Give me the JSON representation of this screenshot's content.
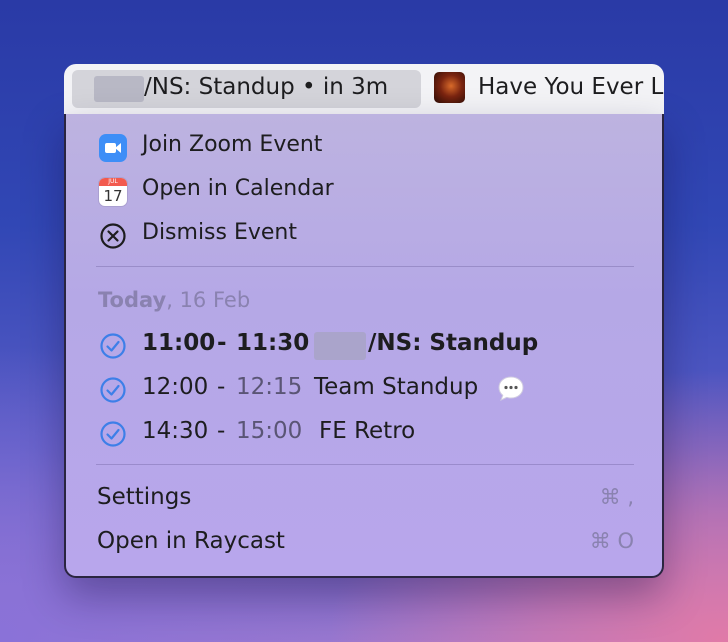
{
  "menubar": {
    "event_text": "/NS: Standup • in 3m",
    "music_text": "Have You Ever L"
  },
  "actions": [
    {
      "label": "Join Zoom Event",
      "icon": "zoom-icon"
    },
    {
      "label": "Open in Calendar",
      "icon": "calendar-icon",
      "cal_month": "JUL",
      "cal_day": "17"
    },
    {
      "label": "Dismiss Event",
      "icon": "dismiss-icon"
    }
  ],
  "section": {
    "day_label": "Today",
    "date_label": ", 16 Feb"
  },
  "events": [
    {
      "start": "11:00",
      "dash": "-",
      "end": "11:30",
      "title": "/NS: Standup",
      "current": true
    },
    {
      "start": "12:00",
      "dash": "-",
      "end": "12:15",
      "title": "Team Standup",
      "current": false
    },
    {
      "start": "14:30",
      "dash": "-",
      "end": "15:00",
      "title": "FE Retro",
      "current": false
    }
  ],
  "footer": {
    "settings_label": "Settings",
    "settings_shortcut": "⌘ ,",
    "raycast_label": "Open in Raycast",
    "raycast_shortcut": "⌘ O"
  },
  "colors": {
    "accent": "#3d7fe8",
    "muted": "#8a82b0"
  }
}
